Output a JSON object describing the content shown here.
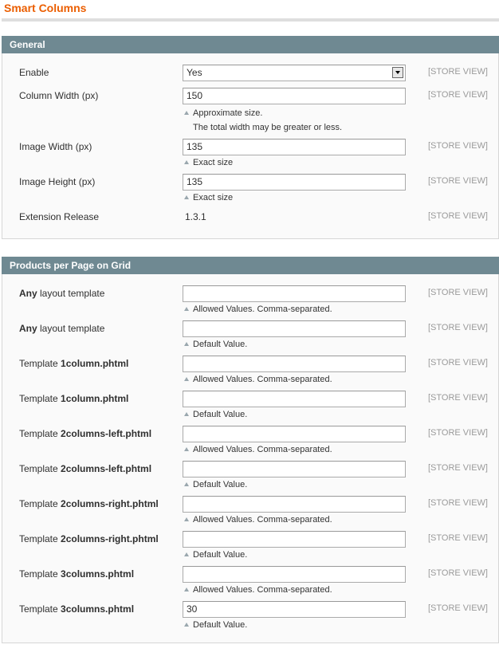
{
  "title": "Smart Columns",
  "general": {
    "header": "General",
    "scope": "[STORE VIEW]",
    "enable": {
      "label": "Enable",
      "value": "Yes"
    },
    "column_width": {
      "label": "Column Width (px)",
      "value": "150",
      "note1": "Approximate size.",
      "note2": "The total width may be greater or less."
    },
    "image_width": {
      "label": "Image Width (px)",
      "value": "135",
      "note": "Exact size"
    },
    "image_height": {
      "label": "Image Height (px)",
      "value": "135",
      "note": "Exact size"
    },
    "release": {
      "label": "Extension Release",
      "value": "1.3.1"
    }
  },
  "grid": {
    "header": "Products per Page on Grid",
    "scope": "[STORE VIEW]",
    "rows": [
      {
        "pre": "",
        "bold": "Any",
        "post": " layout template",
        "value": "",
        "note": "Allowed Values. Comma-separated."
      },
      {
        "pre": "",
        "bold": "Any",
        "post": " layout template",
        "value": "",
        "note": "Default Value."
      },
      {
        "pre": "Template ",
        "bold": "1column.phtml",
        "post": "",
        "value": "",
        "note": "Allowed Values. Comma-separated."
      },
      {
        "pre": "Template ",
        "bold": "1column.phtml",
        "post": "",
        "value": "",
        "note": "Default Value."
      },
      {
        "pre": "Template ",
        "bold": "2columns-left.phtml",
        "post": "",
        "value": "",
        "note": "Allowed Values. Comma-separated."
      },
      {
        "pre": "Template ",
        "bold": "2columns-left.phtml",
        "post": "",
        "value": "",
        "note": "Default Value."
      },
      {
        "pre": "Template ",
        "bold": "2columns-right.phtml",
        "post": "",
        "value": "",
        "note": "Allowed Values. Comma-separated."
      },
      {
        "pre": "Template ",
        "bold": "2columns-right.phtml",
        "post": "",
        "value": "",
        "note": "Default Value."
      },
      {
        "pre": "Template ",
        "bold": "3columns.phtml",
        "post": "",
        "value": "",
        "note": "Allowed Values. Comma-separated."
      },
      {
        "pre": "Template ",
        "bold": "3columns.phtml",
        "post": "",
        "value": "30",
        "note": "Default Value."
      }
    ]
  }
}
